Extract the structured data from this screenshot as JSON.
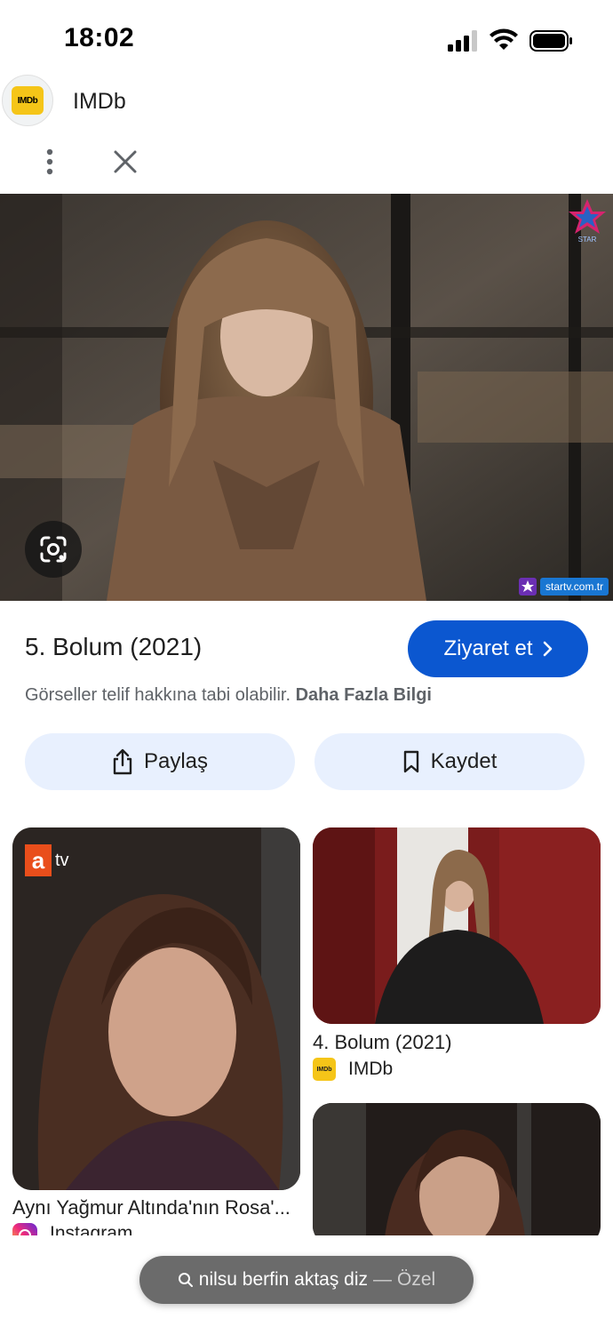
{
  "status_bar": {
    "time": "18:02"
  },
  "header": {
    "site_name": "IMDb",
    "logo_text": "IMDb"
  },
  "main_image": {
    "corner_logo": "STAR",
    "watermark": "startv.com.tr"
  },
  "info": {
    "title": "5. Bolum (2021)",
    "visit_label": "Ziyaret et",
    "copyright_text": "Görseller telif hakkına tabi olabilir.",
    "learn_more": "Daha Fazla Bilgi"
  },
  "actions": {
    "share_label": "Paylaş",
    "save_label": "Kaydet"
  },
  "results": [
    {
      "caption": "Aynı Yağmur Altında'nın Rosa'...",
      "source": "Instagram",
      "logo": "atv"
    },
    {
      "caption": "4. Bolum (2021)",
      "source": "IMDb",
      "logo_text": "IMDb"
    },
    {
      "caption": "",
      "source": ""
    }
  ],
  "search_bar": {
    "query": "nilsu berfin aktaş diz",
    "separator": "—",
    "mode": "Özel"
  },
  "icons": [
    "more-vert-icon",
    "close-icon",
    "lens-icon",
    "share-icon",
    "bookmark-icon",
    "chevron-right-icon",
    "search-icon"
  ],
  "colors": {
    "primary": "#0b57d0",
    "tonal": "#e8f0fe",
    "imdb": "#f5c518"
  }
}
